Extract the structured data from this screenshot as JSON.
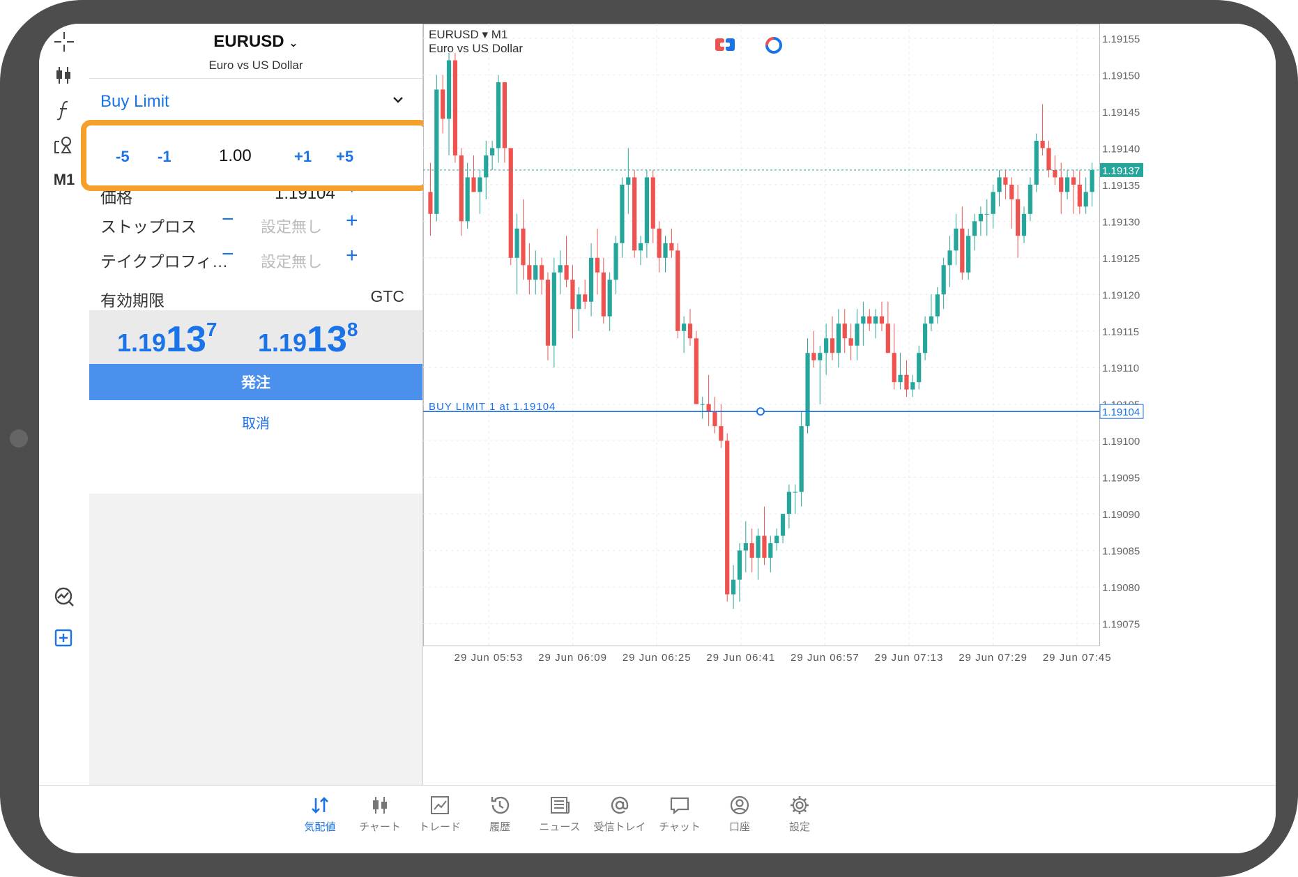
{
  "order": {
    "symbol": "EURUSD",
    "symbol_description": "Euro vs US Dollar",
    "order_type": "Buy Limit",
    "volume": {
      "minus5": "-5",
      "minus1": "-1",
      "value": "1.00",
      "plus1": "+1",
      "plus5": "+5"
    },
    "price_label": "価格",
    "price_value": "1.19104",
    "stoploss_label": "ストップロス",
    "stoploss_value": "設定無し",
    "takeprofit_label": "テイクプロフィ…",
    "takeprofit_value": "設定無し",
    "expiry_label": "有効期限",
    "expiry_value": "GTC",
    "bid": {
      "prefix": "1.19",
      "big": "13",
      "sup": "7"
    },
    "ask": {
      "prefix": "1.19",
      "big": "13",
      "sup": "8"
    },
    "submit_label": "発注",
    "cancel_label": "取消",
    "minus_sign": "−",
    "plus_sign": "+"
  },
  "toolbar": {
    "timeframe": "M1"
  },
  "chart": {
    "symbol_line": "EURUSD ▾ M1",
    "description": "Euro vs US Dollar",
    "buy_limit_label": "BUY LIMIT 1 at 1.19104",
    "current_price_label": "1.19137",
    "order_price_label": "1.19104",
    "colors": {
      "up": "#26a69a",
      "down": "#ef5350",
      "order_line": "#1a73e8",
      "price_line": "#26a69a"
    }
  },
  "chart_data": {
    "type": "candlestick",
    "symbol": "EURUSD",
    "timeframe": "M1",
    "ylim": [
      1.19072,
      1.19157
    ],
    "y_ticks": [
      "1.19155",
      "1.19150",
      "1.19145",
      "1.19140",
      "1.19135",
      "1.19130",
      "1.19125",
      "1.19120",
      "1.19115",
      "1.19110",
      "1.19105",
      "1.19100",
      "1.19095",
      "1.19090",
      "1.19085",
      "1.19080",
      "1.19075"
    ],
    "x_ticks": [
      "29 Jun 05:53",
      "29 Jun 06:09",
      "29 Jun 06:25",
      "29 Jun 06:41",
      "29 Jun 06:57",
      "29 Jun 07:13",
      "29 Jun 07:29",
      "29 Jun 07:45"
    ],
    "current_price": 1.19137,
    "order_price": 1.19104,
    "ohlc": [
      [
        1.19134,
        1.19138,
        1.19128,
        1.19131
      ],
      [
        1.19131,
        1.1915,
        1.1913,
        1.19148
      ],
      [
        1.19148,
        1.1915,
        1.19142,
        1.19144
      ],
      [
        1.19144,
        1.19153,
        1.19139,
        1.19152
      ],
      [
        1.19152,
        1.19153,
        1.19138,
        1.19139
      ],
      [
        1.19139,
        1.1914,
        1.19128,
        1.1913
      ],
      [
        1.1913,
        1.19138,
        1.19129,
        1.19136
      ],
      [
        1.19136,
        1.19139,
        1.19134,
        1.19134
      ],
      [
        1.19134,
        1.19137,
        1.19131,
        1.19136
      ],
      [
        1.19136,
        1.19141,
        1.19133,
        1.19139
      ],
      [
        1.19139,
        1.19141,
        1.19137,
        1.1914
      ],
      [
        1.1914,
        1.1915,
        1.19138,
        1.19149
      ],
      [
        1.19149,
        1.19149,
        1.19138,
        1.1914
      ],
      [
        1.1914,
        1.1914,
        1.19124,
        1.19125
      ],
      [
        1.19125,
        1.19131,
        1.1912,
        1.19129
      ],
      [
        1.19129,
        1.19133,
        1.19122,
        1.19124
      ],
      [
        1.19124,
        1.19127,
        1.1912,
        1.19122
      ],
      [
        1.19122,
        1.19126,
        1.1912,
        1.19124
      ],
      [
        1.19124,
        1.19125,
        1.1912,
        1.19122
      ],
      [
        1.19122,
        1.19123,
        1.19111,
        1.19113
      ],
      [
        1.19113,
        1.19125,
        1.1911,
        1.19123
      ],
      [
        1.19123,
        1.19126,
        1.1912,
        1.19124
      ],
      [
        1.19124,
        1.19128,
        1.19121,
        1.19122
      ],
      [
        1.19122,
        1.19124,
        1.19114,
        1.19118
      ],
      [
        1.19118,
        1.19121,
        1.19115,
        1.1912
      ],
      [
        1.1912,
        1.19122,
        1.19118,
        1.19119
      ],
      [
        1.19119,
        1.19127,
        1.19117,
        1.19125
      ],
      [
        1.19125,
        1.19129,
        1.1912,
        1.19123
      ],
      [
        1.19123,
        1.19125,
        1.19116,
        1.19117
      ],
      [
        1.19117,
        1.19123,
        1.19115,
        1.19122
      ],
      [
        1.19122,
        1.19128,
        1.1912,
        1.19127
      ],
      [
        1.19127,
        1.19136,
        1.19125,
        1.19135
      ],
      [
        1.19135,
        1.1914,
        1.19131,
        1.19136
      ],
      [
        1.19136,
        1.19137,
        1.19125,
        1.19126
      ],
      [
        1.19126,
        1.19128,
        1.19124,
        1.19127
      ],
      [
        1.19127,
        1.19137,
        1.19125,
        1.19136
      ],
      [
        1.19136,
        1.19137,
        1.19127,
        1.19129
      ],
      [
        1.19129,
        1.1913,
        1.19123,
        1.19125
      ],
      [
        1.19125,
        1.19128,
        1.19123,
        1.19127
      ],
      [
        1.19127,
        1.19129,
        1.19125,
        1.19126
      ],
      [
        1.19126,
        1.19127,
        1.19114,
        1.19115
      ],
      [
        1.19115,
        1.19117,
        1.19112,
        1.19116
      ],
      [
        1.19116,
        1.19118,
        1.19113,
        1.19114
      ],
      [
        1.19114,
        1.19115,
        1.19105,
        1.19105
      ],
      [
        1.19105,
        1.19106,
        1.19103,
        1.19105
      ],
      [
        1.19105,
        1.19109,
        1.19102,
        1.19104
      ],
      [
        1.19104,
        1.19106,
        1.19101,
        1.19102
      ],
      [
        1.19102,
        1.19105,
        1.19099,
        1.191
      ],
      [
        1.191,
        1.19101,
        1.19078,
        1.19079
      ],
      [
        1.19079,
        1.19083,
        1.19077,
        1.19081
      ],
      [
        1.19081,
        1.19086,
        1.19078,
        1.19085
      ],
      [
        1.19085,
        1.19089,
        1.19082,
        1.19086
      ],
      [
        1.19086,
        1.19088,
        1.19082,
        1.19084
      ],
      [
        1.19084,
        1.19088,
        1.19081,
        1.19087
      ],
      [
        1.19087,
        1.19091,
        1.19083,
        1.19084
      ],
      [
        1.19084,
        1.19087,
        1.19082,
        1.19086
      ],
      [
        1.19086,
        1.19088,
        1.19085,
        1.19087
      ],
      [
        1.19087,
        1.1909,
        1.19086,
        1.1909
      ],
      [
        1.1909,
        1.19094,
        1.19088,
        1.19093
      ],
      [
        1.19093,
        1.19094,
        1.1909,
        1.19093
      ],
      [
        1.19093,
        1.19104,
        1.19091,
        1.19102
      ],
      [
        1.19102,
        1.19114,
        1.19101,
        1.19112
      ],
      [
        1.19112,
        1.19115,
        1.1911,
        1.19111
      ],
      [
        1.19111,
        1.19113,
        1.19105,
        1.19112
      ],
      [
        1.19112,
        1.19116,
        1.19109,
        1.19114
      ],
      [
        1.19114,
        1.19117,
        1.19111,
        1.19112
      ],
      [
        1.19112,
        1.19118,
        1.1911,
        1.19116
      ],
      [
        1.19116,
        1.19118,
        1.19112,
        1.19114
      ],
      [
        1.19114,
        1.19116,
        1.19111,
        1.19113
      ],
      [
        1.19113,
        1.19118,
        1.19111,
        1.19116
      ],
      [
        1.19116,
        1.19119,
        1.19113,
        1.19117
      ],
      [
        1.19117,
        1.19118,
        1.19115,
        1.19116
      ],
      [
        1.19116,
        1.19118,
        1.19114,
        1.19117
      ],
      [
        1.19117,
        1.19119,
        1.19115,
        1.19116
      ],
      [
        1.19116,
        1.19119,
        1.19112,
        1.19112
      ],
      [
        1.19112,
        1.19116,
        1.19107,
        1.19108
      ],
      [
        1.19108,
        1.19112,
        1.19107,
        1.19109
      ],
      [
        1.19109,
        1.19111,
        1.19106,
        1.19107
      ],
      [
        1.19107,
        1.19109,
        1.19106,
        1.19108
      ],
      [
        1.19108,
        1.19113,
        1.19107,
        1.19112
      ],
      [
        1.19112,
        1.19117,
        1.19111,
        1.19116
      ],
      [
        1.19116,
        1.1912,
        1.19115,
        1.19117
      ],
      [
        1.19117,
        1.19121,
        1.19116,
        1.1912
      ],
      [
        1.1912,
        1.19125,
        1.19118,
        1.19124
      ],
      [
        1.19124,
        1.19128,
        1.19121,
        1.19126
      ],
      [
        1.19126,
        1.19131,
        1.19124,
        1.19129
      ],
      [
        1.19129,
        1.19132,
        1.19122,
        1.19123
      ],
      [
        1.19123,
        1.19129,
        1.19122,
        1.19128
      ],
      [
        1.19128,
        1.19131,
        1.19126,
        1.1913
      ],
      [
        1.1913,
        1.19132,
        1.19128,
        1.19131
      ],
      [
        1.19131,
        1.19133,
        1.19128,
        1.19131
      ],
      [
        1.19131,
        1.19135,
        1.19129,
        1.19134
      ],
      [
        1.19134,
        1.19137,
        1.19132,
        1.19136
      ],
      [
        1.19136,
        1.19137,
        1.19133,
        1.19135
      ],
      [
        1.19135,
        1.19136,
        1.19129,
        1.19133
      ],
      [
        1.19133,
        1.19135,
        1.19125,
        1.19128
      ],
      [
        1.19128,
        1.19132,
        1.19127,
        1.19131
      ],
      [
        1.19131,
        1.19136,
        1.1913,
        1.19135
      ],
      [
        1.19135,
        1.19142,
        1.19134,
        1.19141
      ],
      [
        1.19141,
        1.19146,
        1.19139,
        1.1914
      ],
      [
        1.1914,
        1.19141,
        1.19136,
        1.19137
      ],
      [
        1.19137,
        1.19139,
        1.19135,
        1.19136
      ],
      [
        1.19136,
        1.19138,
        1.19131,
        1.19134
      ],
      [
        1.19134,
        1.19137,
        1.19133,
        1.19136
      ],
      [
        1.19136,
        1.19137,
        1.19131,
        1.19135
      ],
      [
        1.19135,
        1.19137,
        1.19131,
        1.19132
      ],
      [
        1.19132,
        1.19136,
        1.19131,
        1.19134
      ],
      [
        1.19134,
        1.19138,
        1.19132,
        1.19137
      ]
    ]
  },
  "nav": [
    {
      "label": "気配値",
      "icon": "quotes-icon",
      "active": true
    },
    {
      "label": "チャート",
      "icon": "chart-icon",
      "active": false
    },
    {
      "label": "トレード",
      "icon": "trade-icon",
      "active": false
    },
    {
      "label": "履歴",
      "icon": "history-icon",
      "active": false
    },
    {
      "label": "ニュース",
      "icon": "news-icon",
      "active": false
    },
    {
      "label": "受信トレイ",
      "icon": "mailbox-icon",
      "active": false
    },
    {
      "label": "チャット",
      "icon": "chat-icon",
      "active": false
    },
    {
      "label": "口座",
      "icon": "account-icon",
      "active": false
    },
    {
      "label": "設定",
      "icon": "settings-icon",
      "active": false
    }
  ]
}
